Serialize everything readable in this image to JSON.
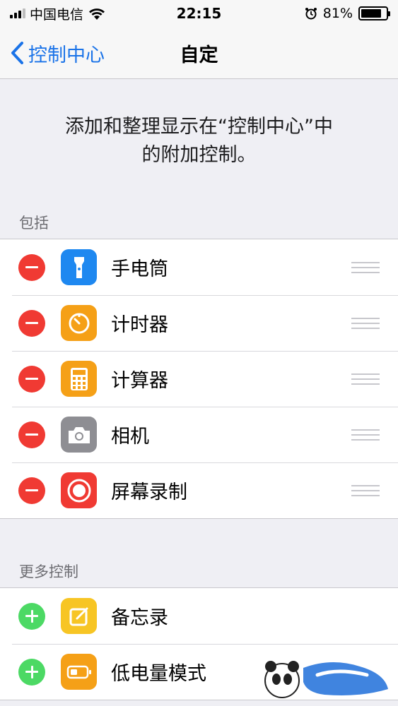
{
  "status_bar": {
    "carrier": "中国电信",
    "time": "22:15",
    "battery_percent": "81%",
    "battery_level": 0.81
  },
  "nav": {
    "back_label": "控制中心",
    "title": "自定"
  },
  "description": {
    "line1": "添加和整理显示在“控制中心”中",
    "line2": "的附加控制。"
  },
  "sections": {
    "included": {
      "header": "包括",
      "items": [
        {
          "label": "手电筒",
          "icon": "flashlight-icon",
          "color": "#1e88f0"
        },
        {
          "label": "计时器",
          "icon": "timer-icon",
          "color": "#f5a017"
        },
        {
          "label": "计算器",
          "icon": "calculator-icon",
          "color": "#f5a017"
        },
        {
          "label": "相机",
          "icon": "camera-icon",
          "color": "#8e8e93"
        },
        {
          "label": "屏幕录制",
          "icon": "screen-record-icon",
          "color": "#f03a33"
        }
      ]
    },
    "more": {
      "header": "更多控制",
      "items": [
        {
          "label": "备忘录",
          "icon": "notes-icon",
          "color": "#f7c524"
        },
        {
          "label": "低电量模式",
          "icon": "low-power-icon",
          "color": "#f5a017"
        }
      ]
    }
  },
  "colors": {
    "accent": "#1a73e8",
    "remove": "#f03a33",
    "add": "#4cd964"
  }
}
